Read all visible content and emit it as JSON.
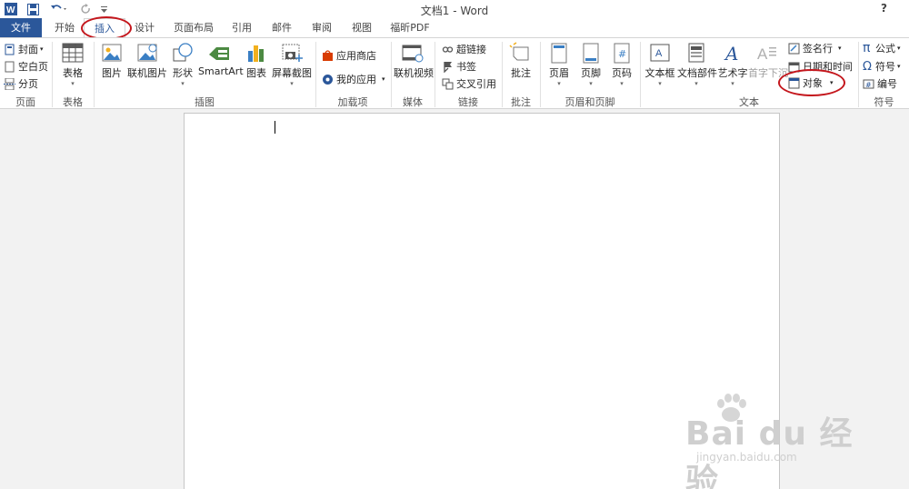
{
  "window": {
    "title": "文档1 - Word",
    "help": "?"
  },
  "quick_access": {
    "app_icon": "word-icon",
    "save": "save-icon",
    "undo": "undo-icon",
    "redo": "redo-icon",
    "customize": "customize-icon"
  },
  "tabs": [
    {
      "label": "文件"
    },
    {
      "label": "开始"
    },
    {
      "label": "插入"
    },
    {
      "label": "设计"
    },
    {
      "label": "页面布局"
    },
    {
      "label": "引用"
    },
    {
      "label": "邮件"
    },
    {
      "label": "审阅"
    },
    {
      "label": "视图"
    },
    {
      "label": "福昕PDF"
    }
  ],
  "ribbon": {
    "pages": {
      "label": "页面",
      "cover": "封面",
      "blank": "空白页",
      "break": "分页"
    },
    "table": {
      "label": "表格",
      "button": "表格"
    },
    "illustrations": {
      "label": "插图",
      "picture": "图片",
      "online_picture": "联机图片",
      "shapes": "形状",
      "smartart": "SmartArt",
      "chart": "图表",
      "screenshot": "屏幕截图"
    },
    "addins": {
      "label": "加载项",
      "store": "应用商店",
      "my_apps": "我的应用"
    },
    "media": {
      "label": "媒体",
      "online_video": "联机视频"
    },
    "links": {
      "label": "链接",
      "hyperlink": "超链接",
      "bookmark": "书签",
      "cross_ref": "交叉引用"
    },
    "comments": {
      "label": "批注",
      "comment": "批注"
    },
    "header_footer": {
      "label": "页眉和页脚",
      "header": "页眉",
      "footer": "页脚",
      "page_number": "页码"
    },
    "text": {
      "label": "文本",
      "textbox": "文本框",
      "quick_parts": "文档部件",
      "wordart": "艺术字",
      "dropcap": "首字下沉",
      "signature": "签名行",
      "datetime": "日期和时间",
      "object": "对象"
    },
    "symbols": {
      "label": "符号",
      "equation": "公式",
      "symbol": "符号",
      "number": "编号"
    }
  },
  "watermark": {
    "main": "Bai du 经验",
    "sub": "jingyan.baidu.com"
  }
}
